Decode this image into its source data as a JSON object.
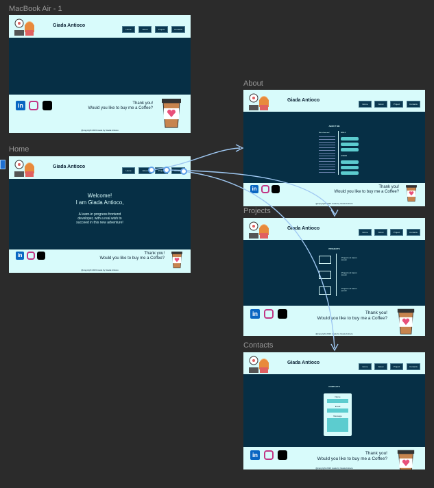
{
  "frames": {
    "macbook": {
      "label": "MacBook Air - 1"
    },
    "home": {
      "label": "Home"
    },
    "about": {
      "label": "About"
    },
    "projects": {
      "label": "Projects"
    },
    "contacts": {
      "label": "Contacts"
    }
  },
  "site": {
    "name": "Giada Antioco",
    "nav": [
      "Home",
      "About",
      "Project",
      "Contacts"
    ],
    "thanks_line1": "Thank you!",
    "thanks_line2": "Would you like to buy me a Coffee?",
    "copyright": "@copyright 2023 made by Giada Antioco"
  },
  "home": {
    "welcome1": "Welcome!",
    "welcome2": "I am Giada Antioco,",
    "desc1": "A learn-in progress frontend",
    "desc2": "developer, with a real wish to",
    "desc3": "succeed in this new adventure!"
  },
  "about": {
    "section_title": "ABOUT ME",
    "skills_label": "SKILLS",
    "hobbies_label": "HOBBIES",
    "intro_heading": "Get to know me!"
  },
  "projects": {
    "section_title": "PROJECTS",
    "items": [
      {
        "label": "Project n.1 lorem ipsum"
      },
      {
        "label": "Project n.2 lorem ipsum"
      },
      {
        "label": "Project n.3 lorem ipsum"
      }
    ]
  },
  "contacts": {
    "section_title": "CONTACTS",
    "name_label": "Name",
    "email_label": "Email",
    "message_label": "Message"
  },
  "colors": {
    "canvas": "#2b2b2b",
    "frame_bg": "#062f45",
    "header_bg": "#d8fbfb",
    "accent": "#5ccccf",
    "connector": "#9fc8f2"
  }
}
